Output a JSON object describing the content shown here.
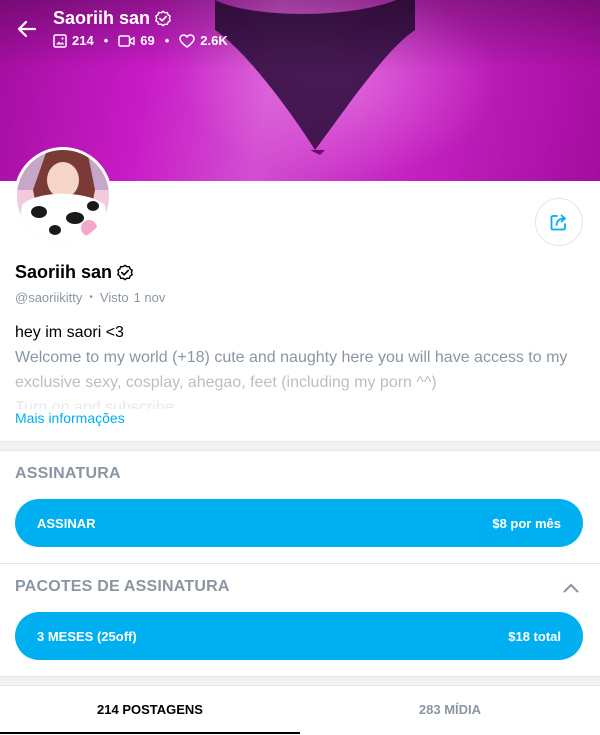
{
  "header": {
    "back_icon": "arrow-left-icon",
    "title": "Saoriih san",
    "verified_icon": "verified-badge-icon",
    "stats": [
      {
        "icon": "image-icon",
        "value": "214"
      },
      {
        "icon": "video-icon",
        "value": "69"
      },
      {
        "icon": "heart-icon",
        "value": "2.6K"
      }
    ],
    "separator": "•"
  },
  "profile": {
    "name": "Saoriih san",
    "handle": "@saoriikitty",
    "separator": "•",
    "last_seen_label": "Visto",
    "last_seen_value": "1 nov",
    "share_icon": "share-icon",
    "bio": [
      "hey im saori <3",
      "Welcome to my world (+18) cute and naughty here you will have access to my",
      "exclusive sexy, cosplay, ahegao, feet (including my porn ^^)",
      "Turn on and subscribe"
    ],
    "more_link": "Mais informações"
  },
  "subscription": {
    "title": "ASSINATURA",
    "button_label": "ASSINAR",
    "button_price": "$8 por mês"
  },
  "bundles": {
    "title": "PACOTES DE ASSINATURA",
    "toggle_icon": "chevron-up-icon",
    "items": [
      {
        "label": "3 MESES (25off)",
        "price": "$18 total"
      }
    ]
  },
  "tabs": [
    {
      "label": "214 POSTAGENS",
      "active": true
    },
    {
      "label": "283 MÍDIA",
      "active": false
    }
  ],
  "colors": {
    "accent": "#00aff0",
    "muted_text": "#8a96a3",
    "cover": "#c81bc6"
  }
}
